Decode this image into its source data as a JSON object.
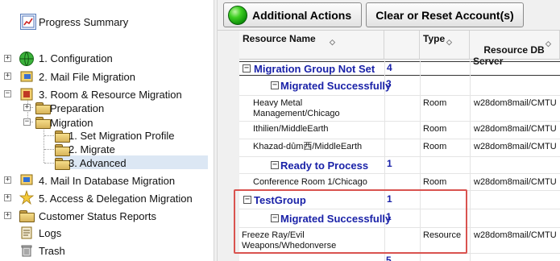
{
  "nav": {
    "items": [
      {
        "label": "Progress Summary",
        "icon": "progress-summary-icon",
        "color": "#2a5db0"
      },
      {
        "label": "1. Configuration",
        "icon": "globe-icon",
        "color": "#2e9e2e"
      },
      {
        "label": "2. Mail File Migration",
        "icon": "mail-file-icon",
        "color": "#3366cc"
      },
      {
        "label": "3. Room & Resource Migration",
        "icon": "room-resource-icon",
        "color": "#b0321e"
      },
      {
        "label": "Preparation",
        "icon": "folder-icon"
      },
      {
        "label": "Migration",
        "icon": "folder-open-icon"
      },
      {
        "label": "1. Set Migration Profile",
        "icon": "folder-icon"
      },
      {
        "label": "2. Migrate",
        "icon": "folder-icon"
      },
      {
        "label": "3. Advanced",
        "icon": "folder-icon",
        "selected": true
      },
      {
        "label": "4. Mail In Database Migration",
        "icon": "mail-in-db-icon"
      },
      {
        "label": "5. Access & Delegation Migration",
        "icon": "delegation-icon"
      },
      {
        "label": "Customer Status Reports",
        "icon": "folder-icon"
      },
      {
        "label": "Logs",
        "icon": "logs-icon"
      },
      {
        "label": "Trash",
        "icon": "trash-icon"
      }
    ],
    "selection_color": "#dce7f4"
  },
  "toolbar": {
    "additional_actions_label": "Additional Actions",
    "clear_reset_label": "Clear or Reset Account(s)"
  },
  "grid": {
    "columns": [
      {
        "label": "Resource Name"
      },
      {
        "label": "Type"
      },
      {
        "label": "Resource DB\nServer"
      }
    ],
    "groups": [
      {
        "label": "Migration Group Not Set",
        "count": "4",
        "subgroups": [
          {
            "label": "Migrated Successfully",
            "count": "3",
            "rows": [
              {
                "name": "Heavy Metal\nManagement/Chicago",
                "type": "Room",
                "server": "w28dom8mail/CMTU"
              },
              {
                "name": "Ithilien/MiddleEarth",
                "type": "Room",
                "server": "w28dom8mail/CMTU"
              },
              {
                "name": "Khazad-dûm西/MiddleEarth",
                "type": "Room",
                "server": "w28dom8mail/CMTU"
              }
            ]
          },
          {
            "label": "Ready to Process",
            "count": "1",
            "rows": [
              {
                "name": "Conference Room 1/Chicago",
                "type": "Room",
                "server": "w28dom8mail/CMTU"
              }
            ]
          }
        ]
      },
      {
        "label": "TestGroup",
        "count": "1",
        "subgroups": [
          {
            "label": "Migrated Successfully",
            "count": "1",
            "rows": [
              {
                "name": "Freeze Ray/Evil\nWeapons/Whedonverse",
                "type": "Resource",
                "server": "w28dom8mail/CMTU"
              }
            ]
          }
        ]
      }
    ],
    "trailing_count": "5"
  },
  "colors": {
    "group_text": "#1a22a8",
    "highlight_box": "#d9534f",
    "green_button": "#1faa14"
  }
}
